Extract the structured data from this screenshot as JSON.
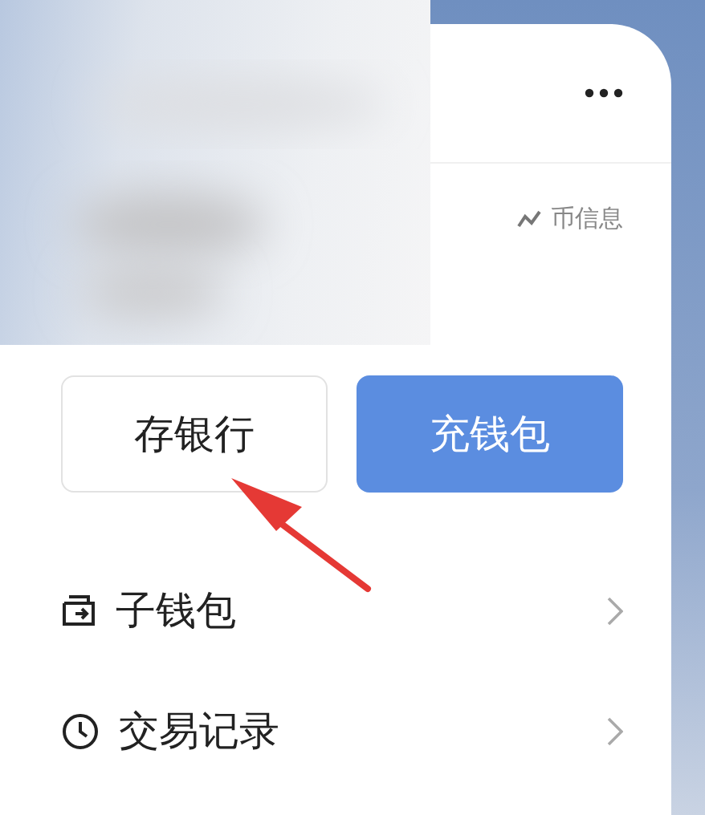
{
  "coin_info": {
    "label": "币信息"
  },
  "buttons": [
    {
      "label": "存银行",
      "kind": "outline"
    },
    {
      "label": "充钱包",
      "kind": "primary"
    }
  ],
  "menu": [
    {
      "label": "子钱包",
      "kind": "wallet"
    },
    {
      "label": "交易记录",
      "kind": "history"
    }
  ]
}
